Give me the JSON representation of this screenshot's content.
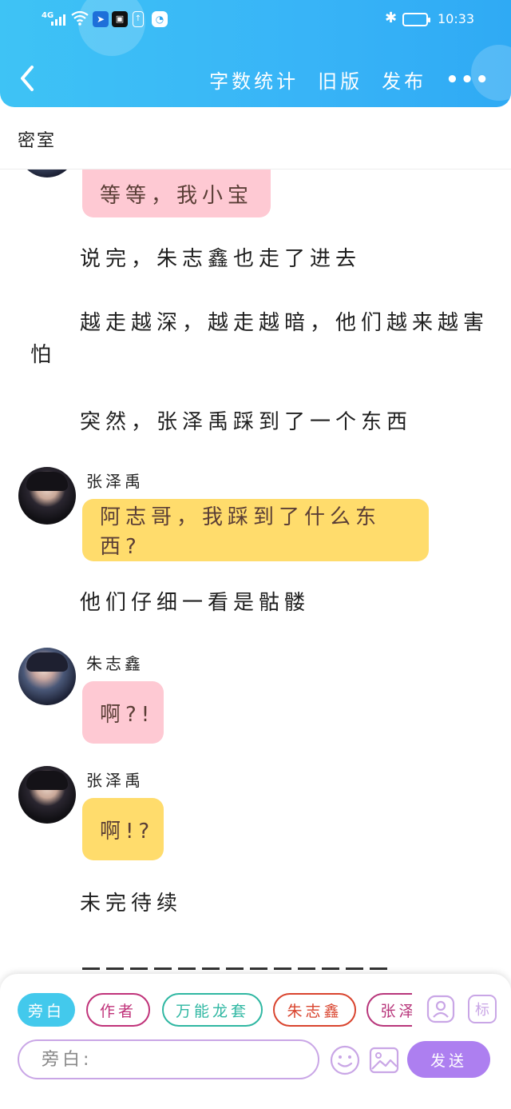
{
  "status_bar": {
    "network": "4G",
    "time": "10:33"
  },
  "header": {
    "word_count": "字数统计",
    "old_version": "旧版",
    "publish": "发布",
    "more": "•••"
  },
  "title": "密室",
  "messages": [
    {
      "type": "bubble",
      "color": "pink",
      "text": "等等，我小宝"
    },
    {
      "type": "narration",
      "text": "说完，朱志鑫也走了进去"
    },
    {
      "type": "narration",
      "text_line1": "越走越深，越走越暗，他们越来越害",
      "text_line2": "怕"
    },
    {
      "type": "narration",
      "text": "突然，张泽禹踩到了一个东西"
    },
    {
      "type": "dialog",
      "speaker": "张泽禹",
      "color": "yellow",
      "text": "阿志哥，我踩到了什么东西?"
    },
    {
      "type": "narration",
      "text": "他们仔细一看是骷髅"
    },
    {
      "type": "dialog",
      "speaker": "朱志鑫",
      "color": "pink",
      "text": "啊?!"
    },
    {
      "type": "dialog",
      "speaker": "张泽禹",
      "color": "yellow",
      "text": "啊!?"
    },
    {
      "type": "narration",
      "text": "未完待续"
    }
  ],
  "composer": {
    "chips": [
      {
        "label": "旁白",
        "color": "#43c9ec",
        "active": true
      },
      {
        "label": "作者",
        "color": "#c0337a",
        "active": false
      },
      {
        "label": "万能龙套",
        "color": "#2fb7a2",
        "active": false
      },
      {
        "label": "朱志鑫",
        "color": "#d9442e",
        "active": false
      },
      {
        "label": "张泽禹",
        "color": "#b8367b",
        "active": false
      }
    ],
    "input_placeholder": "旁白:",
    "send_label": "发送",
    "mark_label": "标",
    "icons": [
      "add-character-icon",
      "mark-icon",
      "emoji-icon",
      "image-icon"
    ],
    "accent": "#ad7ff0"
  }
}
